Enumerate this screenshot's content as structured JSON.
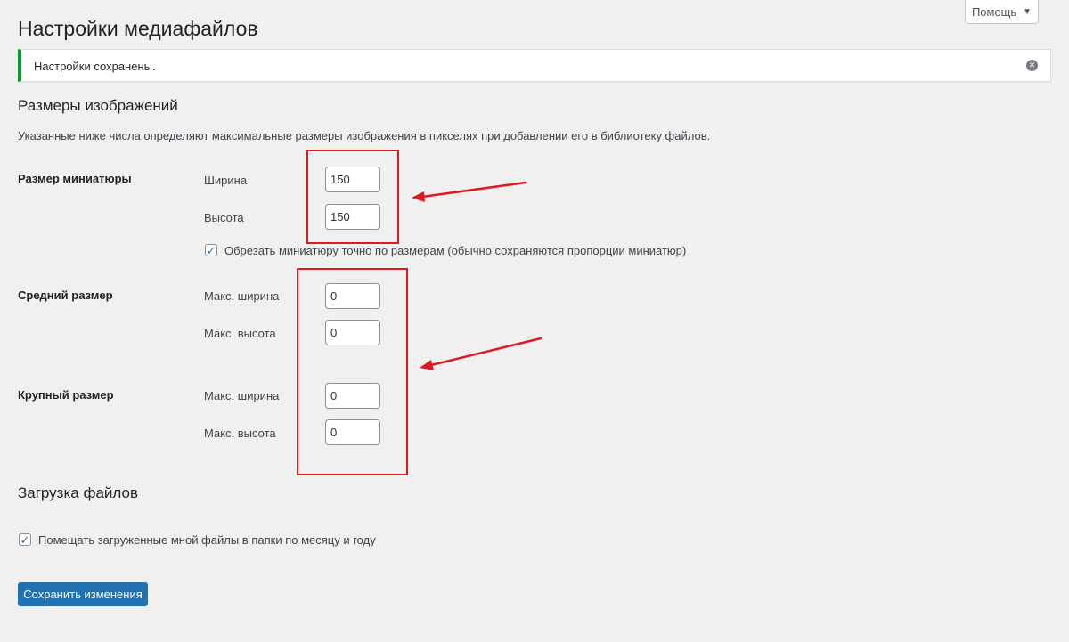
{
  "help": {
    "label": "Помощь",
    "arrow": "▼"
  },
  "page_title": "Настройки медиафайлов",
  "notice": {
    "text": "Настройки сохранены.",
    "dismiss_glyph": "✕"
  },
  "image_sizes": {
    "heading": "Размеры изображений",
    "description": "Указанные ниже числа определяют максимальные размеры изображения в пикселях при добавлении его в библиотеку файлов.",
    "thumbnail": {
      "label": "Размер миниатюры",
      "width_label": "Ширина",
      "width_value": "150",
      "height_label": "Высота",
      "height_value": "150",
      "crop_checked": true,
      "crop_label": "Обрезать миниатюру точно по размерам (обычно сохраняются пропорции миниатюр)"
    },
    "medium": {
      "label": "Средний размер",
      "width_label": "Макс. ширина",
      "width_value": "0",
      "height_label": "Макс. высота",
      "height_value": "0"
    },
    "large": {
      "label": "Крупный размер",
      "width_label": "Макс. ширина",
      "width_value": "0",
      "height_label": "Макс. высота",
      "height_value": "0"
    }
  },
  "uploads": {
    "heading": "Загрузка файлов",
    "organize_checked": true,
    "organize_label": "Помещать загруженные мной файлы в папки по месяцу и году"
  },
  "save_label": "Сохранить изменения",
  "colors": {
    "annotation": "#e0191f",
    "primary": "#2271b1",
    "success": "#00a32a"
  }
}
